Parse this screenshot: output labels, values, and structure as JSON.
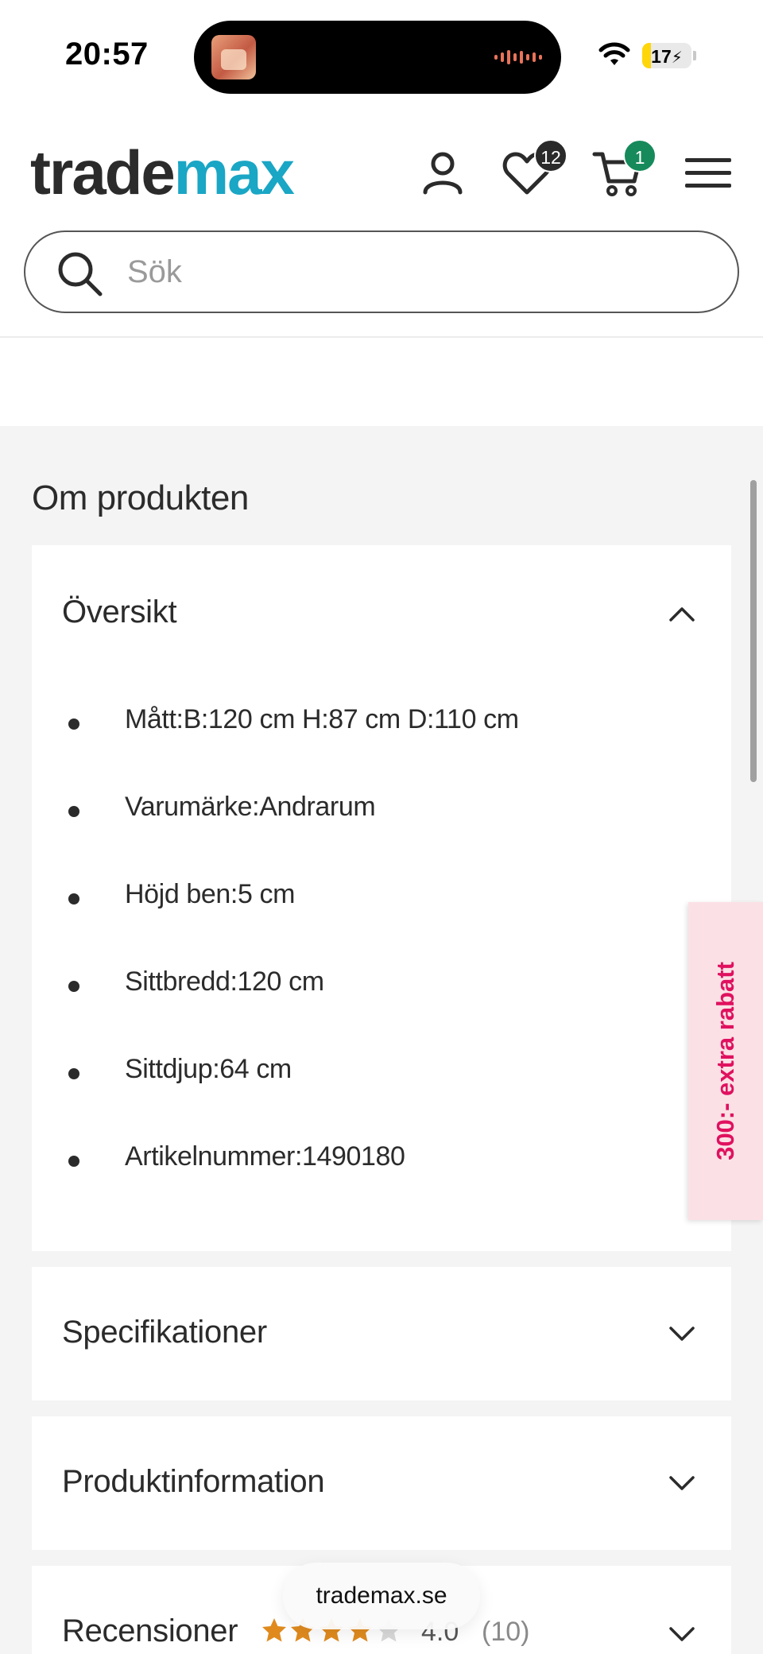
{
  "status_bar": {
    "time": "20:57",
    "battery": "17",
    "battery_level": 0.17
  },
  "header": {
    "logo_part1": "trade",
    "logo_part2": "max",
    "wishlist_count": "12",
    "cart_count": "1",
    "search_placeholder": "Sök"
  },
  "section": {
    "title": "Om produkten"
  },
  "overview": {
    "title": "Översikt",
    "items": [
      "Mått:B:120 cm H:87 cm D:110 cm",
      "Varumärke:Andrarum",
      "Höjd ben:5 cm",
      "Sittbredd:120 cm",
      "Sittdjup:64 cm",
      "Artikelnummer:1490180"
    ]
  },
  "accordions": {
    "specs": "Specifikationer",
    "product_info": "Produktinformation",
    "reviews": "Recensioner",
    "rating_value": "4.0",
    "rating_count": "(10)",
    "rating_stars": 4
  },
  "promo": {
    "label": "300:- extra rabatt"
  },
  "browser": {
    "url": "trademax.se"
  },
  "colors": {
    "brand_dark": "#2b2b2b",
    "brand_accent": "#1aa6c5",
    "cart_badge": "#168a5a",
    "promo_text": "#e0115f",
    "promo_bg": "#fbe1e6",
    "star": "#e08a1e"
  }
}
